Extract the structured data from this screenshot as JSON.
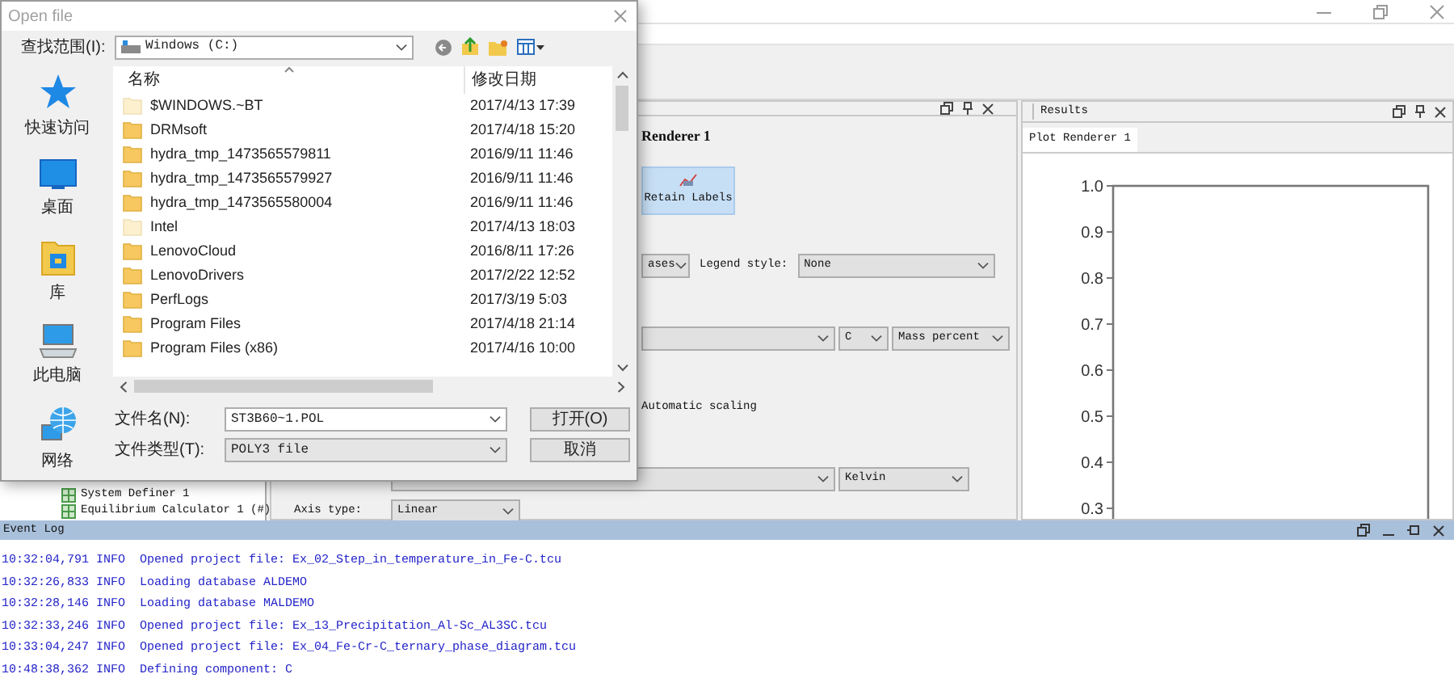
{
  "project_tree": {
    "items": [
      {
        "label": "System Definer 1"
      },
      {
        "label": "Equilibrium Calculator 1 (#)"
      }
    ]
  },
  "config_panel": {
    "title": "Renderer 1",
    "retain_button": "Retain Labels",
    "phases_field": "ases",
    "legend_label": "Legend style:",
    "legend_value": "None",
    "element_value": "C",
    "unit_value": "Mass percent",
    "auto_scaling_label": "Automatic scaling",
    "temperature_unit": "Kelvin",
    "axis_type_label": "Axis type:",
    "axis_type_value": "Linear"
  },
  "results_panel": {
    "title": "Results",
    "tabs": [
      {
        "label": "Plot Renderer 1",
        "selected": true
      }
    ],
    "y_ticks": [
      "1.0",
      "0.9",
      "0.8",
      "0.7",
      "0.6",
      "0.5",
      "0.4",
      "0.3"
    ]
  },
  "event_log": {
    "title": "Event Log",
    "lines": [
      "10:32:04,791 INFO  Opened project file: Ex_02_Step_in_temperature_in_Fe-C.tcu",
      "10:32:26,833 INFO  Loading database ALDEMO",
      "10:32:28,146 INFO  Loading database MALDEMO",
      "10:32:33,246 INFO  Opened project file: Ex_13_Precipitation_Al-Sc_AL3SC.tcu",
      "10:33:04,247 INFO  Opened project file: Ex_04_Fe-Cr-C_ternary_phase_diagram.tcu",
      "10:48:38,362 INFO  Defining component: C"
    ]
  },
  "open_dialog": {
    "title": "Open file",
    "look_in_label": "查找范围(I):",
    "look_in_value": "Windows (C:)",
    "places": [
      {
        "label": "快速访问",
        "kind": "quick"
      },
      {
        "label": "桌面",
        "kind": "desktop"
      },
      {
        "label": "库",
        "kind": "library"
      },
      {
        "label": "此电脑",
        "kind": "computer"
      },
      {
        "label": "网络",
        "kind": "network"
      }
    ],
    "columns": [
      "名称",
      "修改日期"
    ],
    "files": [
      {
        "name": "$WINDOWS.~BT",
        "modified": "2017/4/13 17:39",
        "hidden": true
      },
      {
        "name": "DRMsoft",
        "modified": "2017/4/18 15:20",
        "hidden": false
      },
      {
        "name": "hydra_tmp_1473565579811",
        "modified": "2016/9/11 11:46",
        "hidden": false
      },
      {
        "name": "hydra_tmp_1473565579927",
        "modified": "2016/9/11 11:46",
        "hidden": false
      },
      {
        "name": "hydra_tmp_1473565580004",
        "modified": "2016/9/11 11:46",
        "hidden": false
      },
      {
        "name": "Intel",
        "modified": "2017/4/13 18:03",
        "hidden": true
      },
      {
        "name": "LenovoCloud",
        "modified": "2016/8/11 17:26",
        "hidden": false
      },
      {
        "name": "LenovoDrivers",
        "modified": "2017/2/22 12:52",
        "hidden": false
      },
      {
        "name": "PerfLogs",
        "modified": "2017/3/19 5:03",
        "hidden": false
      },
      {
        "name": "Program Files",
        "modified": "2017/4/18 21:14",
        "hidden": false
      },
      {
        "name": "Program Files (x86)",
        "modified": "2017/4/16 10:00",
        "hidden": false
      }
    ],
    "file_name_label": "文件名(N):",
    "file_name_value": "ST3B60~1.POL",
    "file_type_label": "文件类型(T):",
    "file_type_value": "POLY3 file",
    "buttons": [
      "打开(O)",
      "取消"
    ]
  }
}
